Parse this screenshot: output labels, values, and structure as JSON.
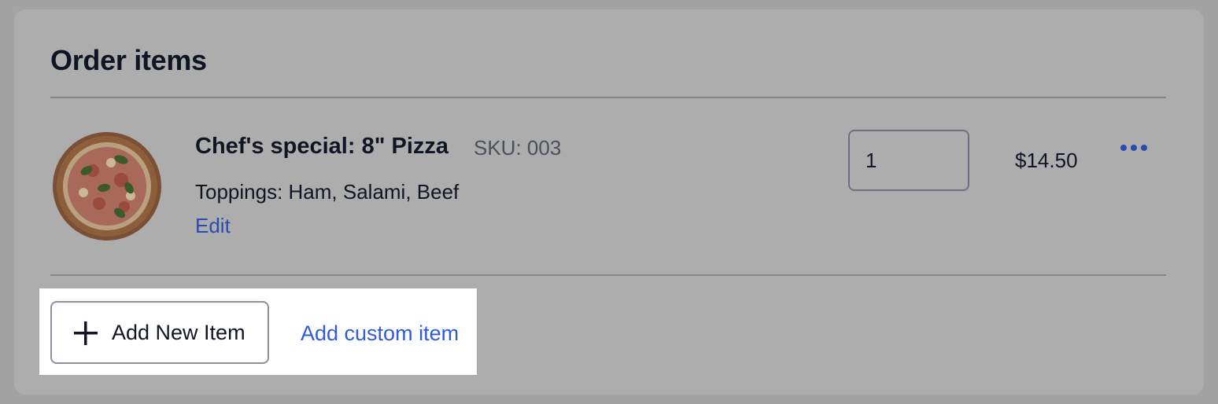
{
  "section": {
    "title": "Order items"
  },
  "item": {
    "image": "pizza-thumbnail",
    "name": "Chef's special: 8\" Pizza",
    "sku": "SKU: 003",
    "toppings": "Toppings: Ham, Salami, Beef",
    "edit_label": "Edit",
    "quantity": "1",
    "price": "$14.50",
    "more_icon": "more-horizontal-icon"
  },
  "actions": {
    "add_new_item_label": "Add New Item",
    "add_new_item_icon": "plus-icon",
    "add_custom_item_label": "Add custom item"
  },
  "colors": {
    "link": "#2a4bb3",
    "accent_link": "#2f5bd9",
    "text": "#0f1523",
    "overlay": "#adadad",
    "highlight": "#ffffff"
  }
}
